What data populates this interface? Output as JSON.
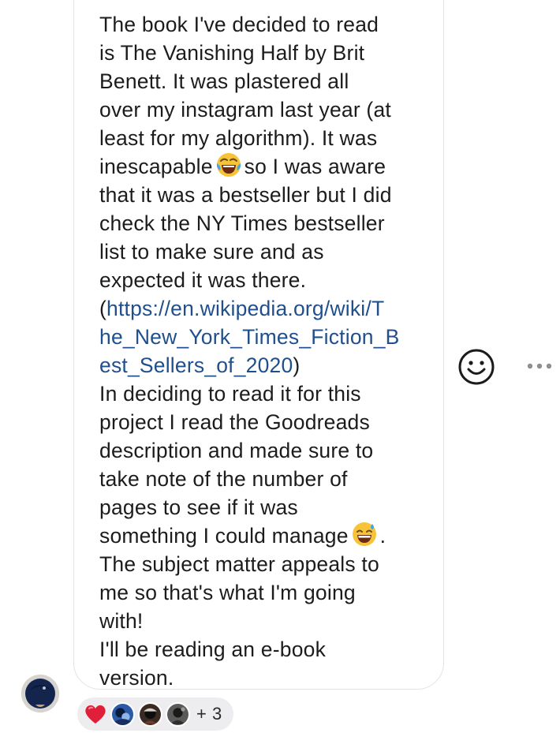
{
  "message": {
    "lines": [
      "The book I've decided to read",
      "is The Vanishing Half by Brit",
      "Benett. It was plastered all",
      "over my instagram last year (at",
      "least for my algorithm). It was",
      "so I was aware",
      "that it was a bestseller but I did",
      "check the NY Times bestseller",
      "list to make sure and as",
      "expected it was there.",
      "(",
      "https://en.wikipedia.org/wiki/T",
      "he_New_York_Times_Fiction_B",
      "est_Sellers_of_2020",
      ")",
      "In deciding to read it for this",
      "project I read the Goodreads",
      "description and made sure to",
      "take note of the number of",
      "pages to see if it was",
      "something I could manage",
      ".",
      "The subject matter appeals to",
      "me so that's what I'm going",
      "with!",
      "I'll be reading an e-book",
      "version."
    ],
    "line6_prefix": "inescapable",
    "emoji_1": "face-with-tears-of-joy-emoji",
    "emoji_2": "grinning-face-with-sweat-emoji",
    "link_color": "#1f4f8c"
  },
  "actions": {
    "react_icon": "smiley-face-icon",
    "more_icon": "more-dots-icon"
  },
  "reactions": {
    "heart_icon": "heart-icon",
    "avatar_count": 3,
    "extra_count": "+ 3"
  },
  "colors": {
    "bubble_border": "#e3e3e6",
    "reaction_bg": "#ededf0",
    "heart": "#e0203a"
  }
}
